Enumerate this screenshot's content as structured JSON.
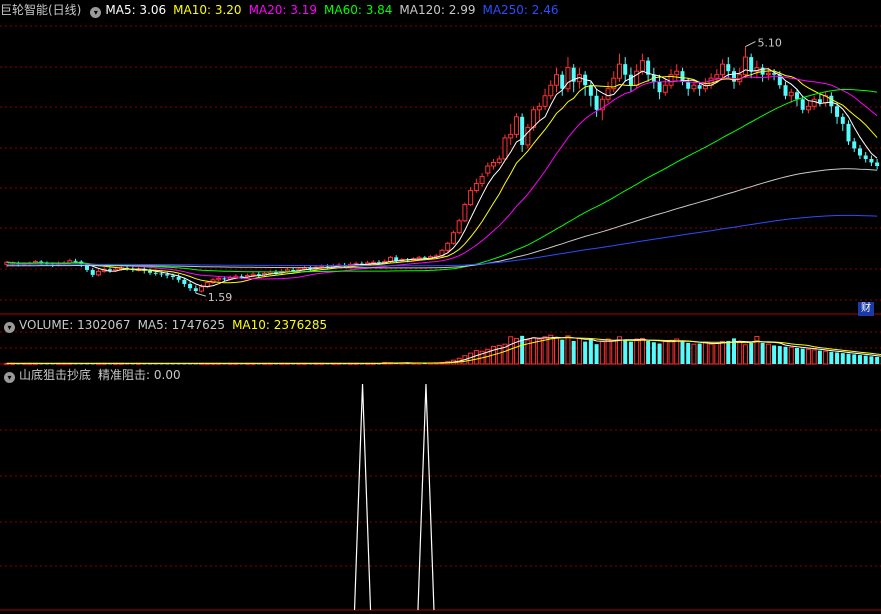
{
  "header": {
    "stock_name": "巨轮智能(日线)",
    "ma": [
      {
        "label": "MA5: 3.06",
        "color": "#ffffff"
      },
      {
        "label": "MA10: 3.20",
        "color": "#ffff00"
      },
      {
        "label": "MA20: 3.19",
        "color": "#ff00ff"
      },
      {
        "label": "MA60: 3.84",
        "color": "#00ff00"
      },
      {
        "label": "MA120: 2.99",
        "color": "#c8c8c8"
      },
      {
        "label": "MA250: 2.46",
        "color": "#2a4dff"
      }
    ]
  },
  "volume_header": [
    {
      "label": "VOLUME: 1302067",
      "color": "#c8c8c8"
    },
    {
      "label": "MA5: 1747625",
      "color": "#c8c8c8"
    },
    {
      "label": "MA10: 2376285",
      "color": "#ffff00"
    }
  ],
  "indicator_header": [
    {
      "label": "山底狙击抄底",
      "color": "#c8c8c8"
    },
    {
      "label": "精准阻击: 0.00",
      "color": "#c8c8c8"
    }
  ],
  "badge": "财",
  "colors": {
    "up": "#ff3232",
    "down": "#54fcfc",
    "grid": "#8b0000",
    "signal": "#ffffff"
  },
  "chart_data": [
    {
      "type": "candlestick",
      "panel": "price",
      "annotations": [
        {
          "text": "5.10",
          "at_value": 5.1,
          "kind": "high"
        },
        {
          "text": "1.59",
          "at_value": 1.59,
          "kind": "low"
        }
      ],
      "ylim": [
        1.35,
        5.45
      ],
      "candles": [
        [
          2.0,
          2.03,
          1.96,
          2.05
        ],
        [
          2.0,
          2.02,
          1.97,
          2.04
        ],
        [
          2.01,
          2.0,
          1.97,
          2.04
        ],
        [
          2.0,
          2.01,
          1.98,
          2.03
        ],
        [
          2.01,
          2.02,
          1.98,
          2.04
        ],
        [
          2.02,
          2.04,
          2.0,
          2.06
        ],
        [
          2.04,
          2.02,
          1.99,
          2.06
        ],
        [
          2.02,
          2.01,
          1.98,
          2.04
        ],
        [
          2.01,
          2.0,
          1.96,
          2.03
        ],
        [
          2.0,
          2.01,
          1.97,
          2.04
        ],
        [
          2.01,
          2.02,
          1.98,
          2.05
        ],
        [
          2.02,
          2.05,
          2.0,
          2.08
        ],
        [
          2.05,
          2.04,
          2.01,
          2.08
        ],
        [
          2.04,
          2.0,
          1.96,
          2.06
        ],
        [
          2.0,
          1.92,
          1.89,
          2.02
        ],
        [
          1.92,
          1.85,
          1.82,
          1.95
        ],
        [
          1.85,
          1.9,
          1.83,
          1.93
        ],
        [
          1.9,
          1.93,
          1.88,
          1.96
        ],
        [
          1.93,
          1.91,
          1.88,
          1.96
        ],
        [
          1.91,
          1.93,
          1.89,
          1.96
        ],
        [
          1.93,
          1.95,
          1.91,
          1.98
        ],
        [
          1.95,
          1.94,
          1.91,
          1.98
        ],
        [
          1.94,
          1.92,
          1.89,
          1.97
        ],
        [
          1.92,
          1.93,
          1.9,
          1.96
        ],
        [
          1.93,
          1.91,
          1.87,
          1.96
        ],
        [
          1.91,
          1.88,
          1.85,
          1.94
        ],
        [
          1.88,
          1.87,
          1.84,
          1.91
        ],
        [
          1.87,
          1.86,
          1.82,
          1.9
        ],
        [
          1.86,
          1.84,
          1.8,
          1.89
        ],
        [
          1.84,
          1.82,
          1.78,
          1.87
        ],
        [
          1.82,
          1.78,
          1.74,
          1.86
        ],
        [
          1.78,
          1.72,
          1.68,
          1.81
        ],
        [
          1.72,
          1.66,
          1.62,
          1.76
        ],
        [
          1.66,
          1.62,
          1.59,
          1.7
        ],
        [
          1.62,
          1.68,
          1.6,
          1.72
        ],
        [
          1.68,
          1.74,
          1.66,
          1.77
        ],
        [
          1.74,
          1.78,
          1.72,
          1.81
        ],
        [
          1.78,
          1.8,
          1.76,
          1.83
        ],
        [
          1.8,
          1.79,
          1.76,
          1.83
        ],
        [
          1.79,
          1.81,
          1.77,
          1.84
        ],
        [
          1.81,
          1.83,
          1.79,
          1.86
        ],
        [
          1.83,
          1.82,
          1.79,
          1.86
        ],
        [
          1.82,
          1.84,
          1.8,
          1.87
        ],
        [
          1.84,
          1.86,
          1.82,
          1.89
        ],
        [
          1.86,
          1.85,
          1.82,
          1.89
        ],
        [
          1.85,
          1.87,
          1.83,
          1.9
        ],
        [
          1.87,
          1.89,
          1.85,
          1.92
        ],
        [
          1.89,
          1.88,
          1.85,
          1.92
        ],
        [
          1.88,
          1.9,
          1.86,
          1.93
        ],
        [
          1.9,
          1.92,
          1.88,
          1.95
        ],
        [
          1.92,
          1.91,
          1.88,
          1.95
        ],
        [
          1.91,
          1.93,
          1.89,
          1.96
        ],
        [
          1.93,
          1.95,
          1.91,
          1.98
        ],
        [
          1.95,
          1.94,
          1.91,
          1.98
        ],
        [
          1.94,
          1.96,
          1.92,
          1.99
        ],
        [
          1.96,
          1.97,
          1.93,
          2.0
        ],
        [
          1.97,
          1.96,
          1.93,
          2.0
        ],
        [
          1.96,
          1.98,
          1.94,
          2.01
        ],
        [
          1.98,
          1.99,
          1.95,
          2.02
        ],
        [
          1.99,
          1.98,
          1.95,
          2.02
        ],
        [
          1.98,
          2.0,
          1.96,
          2.03
        ],
        [
          2.0,
          2.01,
          1.97,
          2.04
        ],
        [
          2.01,
          2.0,
          1.97,
          2.04
        ],
        [
          2.0,
          2.02,
          1.98,
          2.05
        ],
        [
          2.02,
          2.03,
          1.99,
          2.06
        ],
        [
          2.03,
          2.02,
          1.99,
          2.06
        ],
        [
          2.02,
          2.04,
          2.0,
          2.07
        ],
        [
          2.04,
          2.1,
          2.02,
          2.12
        ],
        [
          2.1,
          2.05,
          2.03,
          2.13
        ],
        [
          2.05,
          2.07,
          2.03,
          2.09
        ],
        [
          2.07,
          2.06,
          2.03,
          2.09
        ],
        [
          2.06,
          2.08,
          2.04,
          2.1
        ],
        [
          2.08,
          2.1,
          2.06,
          2.12
        ],
        [
          2.1,
          2.09,
          2.06,
          2.12
        ],
        [
          2.09,
          2.11,
          2.07,
          2.13
        ],
        [
          2.11,
          2.12,
          2.08,
          2.15
        ],
        [
          2.12,
          2.2,
          2.1,
          2.22
        ],
        [
          2.2,
          2.3,
          2.18,
          2.32
        ],
        [
          2.3,
          2.45,
          2.28,
          2.48
        ],
        [
          2.45,
          2.62,
          2.43,
          2.65
        ],
        [
          2.62,
          2.85,
          2.6,
          2.88
        ],
        [
          2.85,
          3.05,
          2.83,
          3.1
        ],
        [
          3.05,
          3.15,
          3.02,
          3.22
        ],
        [
          3.15,
          3.25,
          3.1,
          3.3
        ],
        [
          3.3,
          3.4,
          3.25,
          3.45
        ],
        [
          3.4,
          3.45,
          3.35,
          3.5
        ],
        [
          3.45,
          3.5,
          3.42,
          3.55
        ],
        [
          3.5,
          3.8,
          3.48,
          3.85
        ],
        [
          3.8,
          3.85,
          3.7,
          4.0
        ],
        [
          3.85,
          4.1,
          3.8,
          4.15
        ],
        [
          4.1,
          3.7,
          3.6,
          4.15
        ],
        [
          3.7,
          3.95,
          3.65,
          4.0
        ],
        [
          3.95,
          4.2,
          3.9,
          4.25
        ],
        [
          4.2,
          4.25,
          4.05,
          4.3
        ],
        [
          4.25,
          4.4,
          4.2,
          4.5
        ],
        [
          4.4,
          4.55,
          4.35,
          4.62
        ],
        [
          4.55,
          4.7,
          4.45,
          4.8
        ],
        [
          4.7,
          4.5,
          4.4,
          4.75
        ],
        [
          4.5,
          4.8,
          4.45,
          4.95
        ],
        [
          4.8,
          4.6,
          4.45,
          4.85
        ],
        [
          4.6,
          4.7,
          4.5,
          4.8
        ],
        [
          4.7,
          4.55,
          4.4,
          4.75
        ],
        [
          4.55,
          4.4,
          4.25,
          4.6
        ],
        [
          4.4,
          4.2,
          4.1,
          4.5
        ],
        [
          4.2,
          4.35,
          4.05,
          4.4
        ],
        [
          4.35,
          4.5,
          4.3,
          4.6
        ],
        [
          4.5,
          4.65,
          4.45,
          4.75
        ],
        [
          4.65,
          4.85,
          4.6,
          5.0
        ],
        [
          4.85,
          4.7,
          4.6,
          4.95
        ],
        [
          4.7,
          4.55,
          4.45,
          4.8
        ],
        [
          4.55,
          4.75,
          4.5,
          4.85
        ],
        [
          4.75,
          4.9,
          4.7,
          5.0
        ],
        [
          4.9,
          4.7,
          4.6,
          4.95
        ],
        [
          4.7,
          4.6,
          4.5,
          4.8
        ],
        [
          4.6,
          4.45,
          4.35,
          4.7
        ],
        [
          4.45,
          4.55,
          4.4,
          4.65
        ],
        [
          4.55,
          4.7,
          4.5,
          4.78
        ],
        [
          4.7,
          4.75,
          4.6,
          4.85
        ],
        [
          4.75,
          4.6,
          4.55,
          4.8
        ],
        [
          4.6,
          4.5,
          4.4,
          4.65
        ],
        [
          4.5,
          4.55,
          4.45,
          4.62
        ],
        [
          4.55,
          4.5,
          4.4,
          4.6
        ],
        [
          4.5,
          4.55,
          4.45,
          4.65
        ],
        [
          4.55,
          4.65,
          4.5,
          4.72
        ],
        [
          4.65,
          4.7,
          4.6,
          4.78
        ],
        [
          4.7,
          4.85,
          4.65,
          4.92
        ],
        [
          4.85,
          4.75,
          4.65,
          4.95
        ],
        [
          4.75,
          4.6,
          4.5,
          4.8
        ],
        [
          4.6,
          4.7,
          4.55,
          4.8
        ],
        [
          4.7,
          4.95,
          4.65,
          5.1
        ],
        [
          4.95,
          4.75,
          4.65,
          5.0
        ],
        [
          4.75,
          4.8,
          4.65,
          4.9
        ],
        [
          4.8,
          4.7,
          4.6,
          4.85
        ],
        [
          4.7,
          4.72,
          4.62,
          4.8
        ],
        [
          4.72,
          4.7,
          4.62,
          4.78
        ],
        [
          4.7,
          4.55,
          4.5,
          4.75
        ],
        [
          4.55,
          4.4,
          4.35,
          4.6
        ],
        [
          4.4,
          4.45,
          4.3,
          4.5
        ],
        [
          4.45,
          4.35,
          4.25,
          4.5
        ],
        [
          4.35,
          4.2,
          4.15,
          4.4
        ],
        [
          4.2,
          4.25,
          4.15,
          4.32
        ],
        [
          4.25,
          4.35,
          4.2,
          4.4
        ],
        [
          4.35,
          4.3,
          4.25,
          4.42
        ],
        [
          4.3,
          4.4,
          4.25,
          4.45
        ],
        [
          4.4,
          4.25,
          4.15,
          4.45
        ],
        [
          4.25,
          4.1,
          4.0,
          4.3
        ],
        [
          4.1,
          4.0,
          3.9,
          4.15
        ],
        [
          4.0,
          3.75,
          3.7,
          4.05
        ],
        [
          3.75,
          3.65,
          3.6,
          3.8
        ],
        [
          3.65,
          3.55,
          3.5,
          3.7
        ],
        [
          3.55,
          3.5,
          3.45,
          3.6
        ],
        [
          3.5,
          3.45,
          3.4,
          3.55
        ],
        [
          3.45,
          3.4,
          3.35,
          3.5
        ]
      ],
      "lines": [
        {
          "name": "MA5",
          "color": "#ffffff",
          "period": 5
        },
        {
          "name": "MA10",
          "color": "#ffff00",
          "period": 10
        },
        {
          "name": "MA20",
          "color": "#ff00ff",
          "period": 20
        },
        {
          "name": "MA60",
          "color": "#00ff00",
          "period": 60
        },
        {
          "name": "MA120",
          "color": "#c8c8c8",
          "period": 120,
          "base": 1.98
        },
        {
          "name": "MA250",
          "color": "#2a4dff",
          "period": 250,
          "base": 2.0
        }
      ]
    },
    {
      "type": "bar",
      "panel": "volume",
      "ylim": [
        0,
        1
      ],
      "values": [
        0.02,
        0.02,
        0.02,
        0.02,
        0.02,
        0.02,
        0.02,
        0.02,
        0.02,
        0.02,
        0.02,
        0.02,
        0.02,
        0.02,
        0.02,
        0.02,
        0.02,
        0.02,
        0.02,
        0.02,
        0.02,
        0.02,
        0.02,
        0.02,
        0.02,
        0.02,
        0.02,
        0.02,
        0.02,
        0.02,
        0.02,
        0.02,
        0.02,
        0.02,
        0.02,
        0.02,
        0.02,
        0.02,
        0.02,
        0.02,
        0.02,
        0.02,
        0.02,
        0.02,
        0.02,
        0.02,
        0.02,
        0.02,
        0.02,
        0.02,
        0.02,
        0.02,
        0.02,
        0.02,
        0.02,
        0.02,
        0.02,
        0.02,
        0.02,
        0.02,
        0.02,
        0.02,
        0.02,
        0.02,
        0.02,
        0.02,
        0.05,
        0.04,
        0.03,
        0.03,
        0.03,
        0.03,
        0.03,
        0.03,
        0.03,
        0.03,
        0.05,
        0.08,
        0.12,
        0.18,
        0.26,
        0.34,
        0.42,
        0.4,
        0.46,
        0.55,
        0.58,
        0.62,
        0.85,
        0.8,
        0.88,
        0.75,
        0.82,
        0.78,
        0.85,
        0.9,
        0.82,
        0.76,
        0.88,
        0.72,
        0.8,
        0.7,
        0.76,
        0.62,
        0.7,
        0.78,
        0.72,
        0.85,
        0.74,
        0.7,
        0.78,
        0.8,
        0.72,
        0.68,
        0.64,
        0.7,
        0.74,
        0.78,
        0.7,
        0.66,
        0.62,
        0.64,
        0.68,
        0.62,
        0.64,
        0.7,
        0.72,
        0.8,
        0.68,
        0.6,
        0.66,
        0.86,
        0.66,
        0.62,
        0.58,
        0.56,
        0.54,
        0.52,
        0.5,
        0.48,
        0.46,
        0.44,
        0.42,
        0.4,
        0.38,
        0.36,
        0.34,
        0.32,
        0.3,
        0.28,
        0.26,
        0.24,
        0.22,
        0.2,
        0.2,
        0.18,
        0.18,
        0.16,
        0.16
      ],
      "lines": [
        {
          "name": "MA5",
          "color": "#ffffff",
          "period": 5
        },
        {
          "name": "MA10",
          "color": "#ffff00",
          "period": 10
        }
      ]
    },
    {
      "type": "line",
      "panel": "indicator",
      "name": "精准阻击",
      "ylim": [
        0,
        1
      ],
      "spikes": [
        {
          "at_fraction": 0.4115,
          "value": 1
        },
        {
          "at_fraction": 0.4835,
          "value": 1
        }
      ]
    }
  ]
}
